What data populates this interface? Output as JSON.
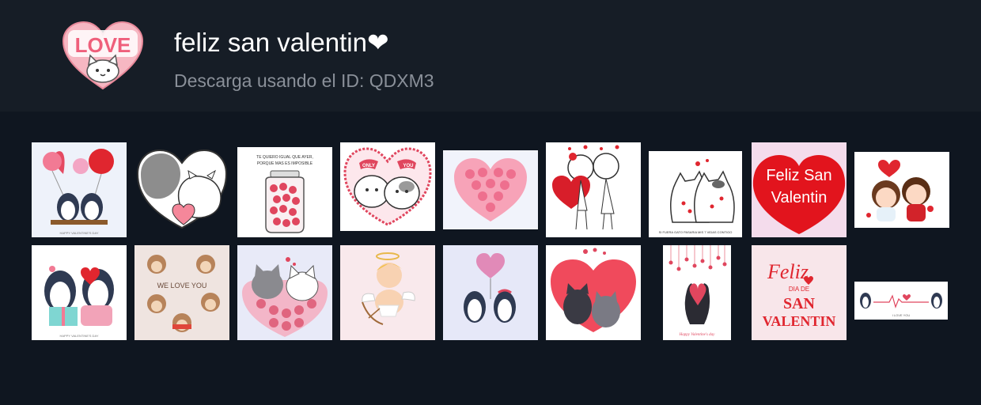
{
  "pack": {
    "title": "feliz san valentin❤",
    "subtitle": "Descarga usando el ID: QDXM3",
    "logo_text": "LOVE"
  },
  "stickers": [
    {
      "name": "penguins-with-balloons",
      "caption": "HAPPY VALENTINE'S DAY"
    },
    {
      "name": "cats-heart-hug",
      "caption": ""
    },
    {
      "name": "jar-of-hearts",
      "caption": "TE QUIERO IGUAL QUE AYER, PORQUE MAS ES IMPOSIBLE"
    },
    {
      "name": "only-you-cats",
      "caption": "ONLY YOU"
    },
    {
      "name": "pink-heart-cluster",
      "caption": ""
    },
    {
      "name": "couple-with-heart",
      "caption": ""
    },
    {
      "name": "cats-in-love",
      "caption": "SI FUERA GATO PASARIA MIS 7 VIDAS CONTIGO"
    },
    {
      "name": "feliz-san-valentin-red-heart",
      "caption": "Feliz San Valentin"
    },
    {
      "name": "chibi-couple",
      "caption": ""
    },
    {
      "name": "penguins-gift-box",
      "caption": "LOVE YOU SO MUCH"
    },
    {
      "name": "hedgehogs-we-love-you",
      "caption": "WE LOVE YOU"
    },
    {
      "name": "cats-on-heart",
      "caption": ""
    },
    {
      "name": "cupid",
      "caption": ""
    },
    {
      "name": "penguins-heart-balloon",
      "caption": ""
    },
    {
      "name": "black-cats-heart",
      "caption": ""
    },
    {
      "name": "cat-silhouettes-hanging-hearts",
      "caption": "Happy Valentine's day"
    },
    {
      "name": "feliz-dia-de-san-valentin-lettering",
      "caption": "Feliz DIA DE SAN VALENTIN"
    },
    {
      "name": "penguins-heartbeat-line",
      "caption": "I LOVE YOU"
    }
  ],
  "colors": {
    "header_bg": "#161d26",
    "page_bg": "#0f1620",
    "accent_red": "#e0262f",
    "accent_pink": "#f27a94"
  }
}
